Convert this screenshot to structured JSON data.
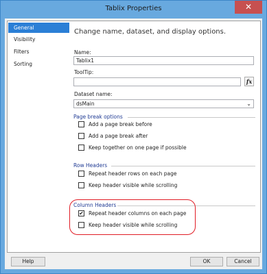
{
  "window": {
    "title": "Tablix Properties",
    "close_glyph": "✕"
  },
  "sidebar": {
    "items": [
      {
        "label": "General",
        "active": true
      },
      {
        "label": "Visibility",
        "active": false
      },
      {
        "label": "Filters",
        "active": false
      },
      {
        "label": "Sorting",
        "active": false
      }
    ]
  },
  "panel": {
    "heading": "Change name, dataset, and display options.",
    "name": {
      "label": "Name:",
      "value": "Tablix1"
    },
    "tooltip": {
      "label": "ToolTip:",
      "value": "",
      "fx_label": "fx"
    },
    "dataset": {
      "label": "Dataset name:",
      "value": "dsMain"
    },
    "page_break": {
      "title": "Page break options",
      "options": [
        {
          "label": "Add a page break before",
          "checked": false
        },
        {
          "label": "Add a page break after",
          "checked": false
        },
        {
          "label": "Keep together on one page if possible",
          "checked": false
        }
      ]
    },
    "row_headers": {
      "title": "Row Headers",
      "options": [
        {
          "label": "Repeat header rows on each page",
          "checked": false
        },
        {
          "label": "Keep header visible while scrolling",
          "checked": false
        }
      ]
    },
    "column_headers": {
      "title": "Column Headers",
      "options": [
        {
          "label": "Repeat header columns on each page",
          "checked": true
        },
        {
          "label": "Keep header visible while scrolling",
          "checked": false
        }
      ]
    }
  },
  "footer": {
    "help": "Help",
    "ok": "OK",
    "cancel": "Cancel"
  },
  "colors": {
    "title_bar": "#68a9df",
    "selection": "#2b7fd6",
    "highlight": "#e01b24",
    "close": "#c75050"
  }
}
